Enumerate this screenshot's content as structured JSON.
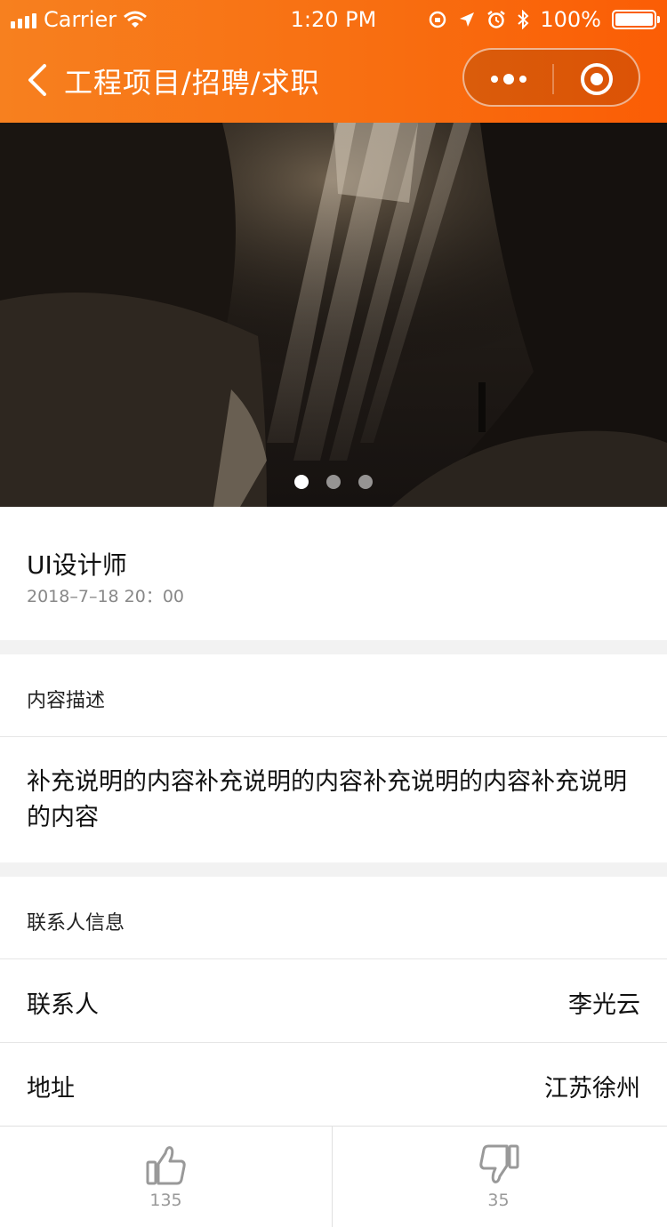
{
  "status_bar": {
    "carrier": "Carrier",
    "time": "1:20 PM",
    "battery": "100%"
  },
  "nav": {
    "title": "工程项目/招聘/求职"
  },
  "banner": {
    "image": "cave-light-rays",
    "slide_count": 3,
    "active_slide": 1
  },
  "job": {
    "title": "UI设计师",
    "date": "2018–7–18 20：00"
  },
  "description": {
    "heading": "内容描述",
    "text": "补充说明的内容补充说明的内容补充说明的内容补充说明的内容"
  },
  "contact": {
    "heading": "联系人信息",
    "rows": [
      {
        "label": "联系人",
        "value": "李光云"
      },
      {
        "label": "地址",
        "value": "江苏徐州"
      }
    ]
  },
  "votes": {
    "up_icon": "thumbs-up-icon",
    "up_count": "135",
    "down_icon": "thumbs-down-icon",
    "down_count": "35"
  },
  "colors": {
    "header_start": "#f7801f",
    "header_end": "#fb5d05",
    "page_bg": "#f2f2f2"
  }
}
